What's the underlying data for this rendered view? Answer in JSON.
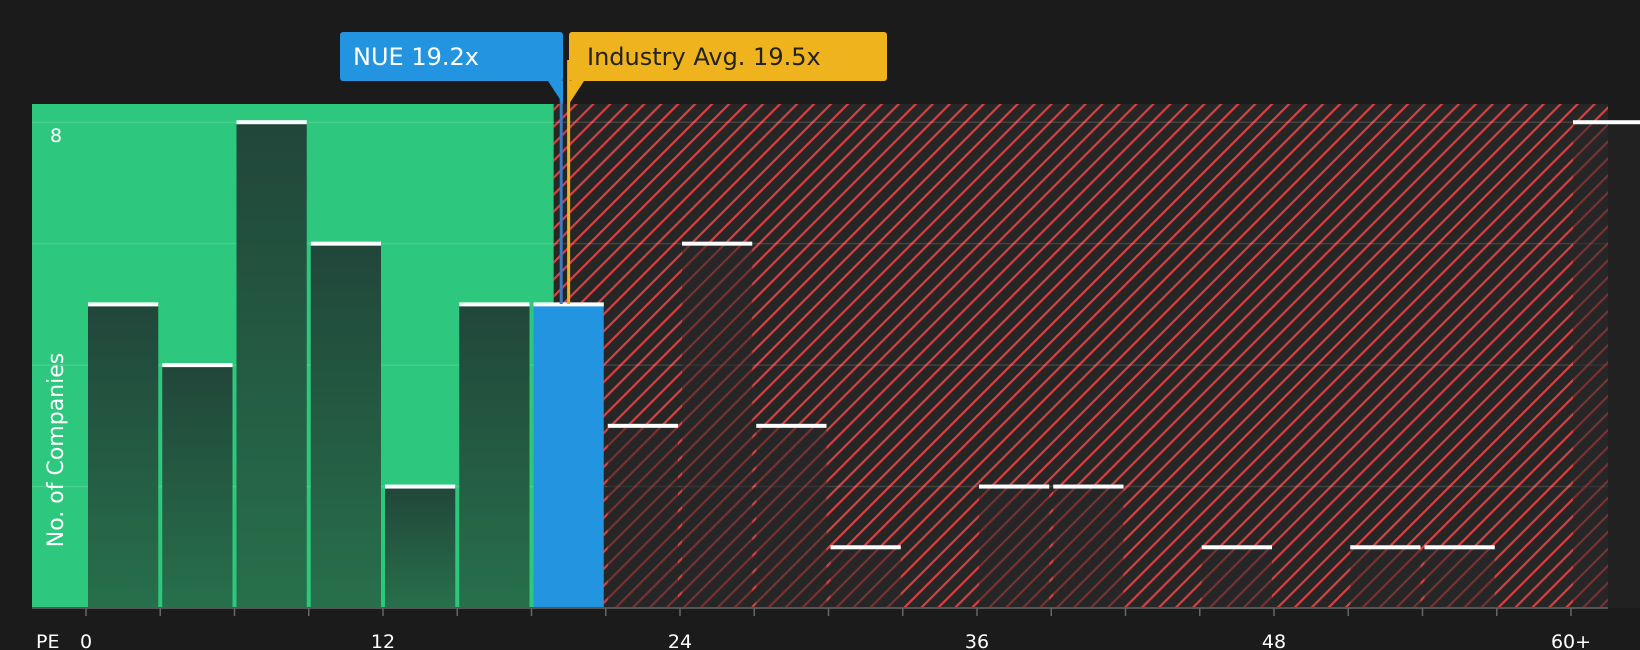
{
  "chart_data": {
    "type": "bar",
    "xlabel": "PE",
    "ylabel": "No. of Companies",
    "x_tick_labels": [
      "0",
      "12",
      "24",
      "36",
      "48",
      "60+"
    ],
    "x_ticks": [
      0,
      12,
      24,
      36,
      48,
      60
    ],
    "x_range": [
      -2.2,
      61.5
    ],
    "y_tick_labels": [
      "8"
    ],
    "ylim": [
      0,
      8.3
    ],
    "bin_width": 3,
    "bins": [
      {
        "start": 0,
        "count": 5,
        "highlight": false
      },
      {
        "start": 3,
        "count": 4,
        "highlight": false
      },
      {
        "start": 6,
        "count": 8,
        "highlight": false
      },
      {
        "start": 9,
        "count": 6,
        "highlight": false
      },
      {
        "start": 12,
        "count": 2,
        "highlight": false
      },
      {
        "start": 15,
        "count": 5,
        "highlight": false
      },
      {
        "start": 18,
        "count": 5,
        "highlight": true
      },
      {
        "start": 21,
        "count": 3,
        "highlight": false
      },
      {
        "start": 24,
        "count": 6,
        "highlight": false
      },
      {
        "start": 27,
        "count": 3,
        "highlight": false
      },
      {
        "start": 30,
        "count": 1,
        "highlight": false
      },
      {
        "start": 33,
        "count": 0,
        "highlight": false
      },
      {
        "start": 36,
        "count": 2,
        "highlight": false
      },
      {
        "start": 39,
        "count": 2,
        "highlight": false
      },
      {
        "start": 42,
        "count": 0,
        "highlight": false
      },
      {
        "start": 45,
        "count": 1,
        "highlight": false
      },
      {
        "start": 48,
        "count": 0,
        "highlight": false
      },
      {
        "start": 51,
        "count": 1,
        "highlight": false
      },
      {
        "start": 54,
        "count": 1,
        "highlight": false
      },
      {
        "start": 57,
        "count": 0,
        "highlight": false
      },
      {
        "start": 60,
        "count": 8,
        "highlight": false
      }
    ],
    "company": {
      "label": "NUE 19.2x",
      "value": 19.2,
      "color": "#2394e0"
    },
    "industry": {
      "label": "Industry Avg. 19.5x",
      "value": 19.5,
      "color": "#efb31d"
    },
    "undervalued_zone_end": 18.9,
    "colors": {
      "background": "#1b1b1b",
      "undervalued": "#2dc77e",
      "overvalued_hatch": "#d94040",
      "bar": "#224a38",
      "bar_dark": "#272727"
    }
  }
}
